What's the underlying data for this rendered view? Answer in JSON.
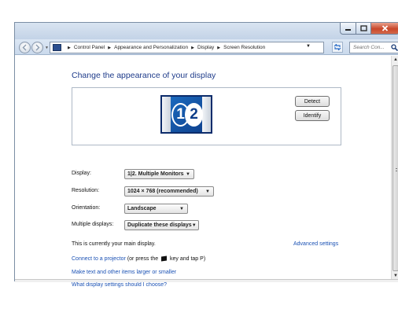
{
  "window": {
    "caption_buttons": {
      "minimize": "minimize-icon",
      "maximize": "maximize-icon",
      "close": "close-icon"
    },
    "close_color": "#c8472a"
  },
  "address_bar": {
    "breadcrumbs": [
      "Control Panel",
      "Appearance and Personalization",
      "Display",
      "Screen Resolution"
    ],
    "search_placeholder": "Search Con..."
  },
  "content": {
    "heading": "Change the appearance of your display",
    "preview": {
      "monitor_numbers": [
        "1",
        "2"
      ]
    },
    "detect_button": "Detect",
    "identify_button": "Identify",
    "fields": {
      "display": {
        "label": "Display:",
        "value": "1|2. Multiple Monitors"
      },
      "resolution": {
        "label": "Resolution:",
        "value": "1024 × 768 (recommended)"
      },
      "orientation": {
        "label": "Orientation:",
        "value": "Landscape"
      },
      "multiple_displays": {
        "label": "Multiple displays:",
        "value": "Duplicate these displays"
      }
    },
    "status_text": "This is currently your main display.",
    "advanced_settings_link": "Advanced settings",
    "projector": {
      "link": "Connect to a projector",
      "text_before": " (or press the ",
      "text_after": " key and tap P)"
    },
    "links": {
      "bigger_text": "Make text and other items larger or smaller",
      "which_settings": "What display settings should I choose?"
    }
  },
  "colors": {
    "link": "#1a51b4",
    "heading": "#1e3b8a",
    "accent": "#1d6fc4"
  }
}
